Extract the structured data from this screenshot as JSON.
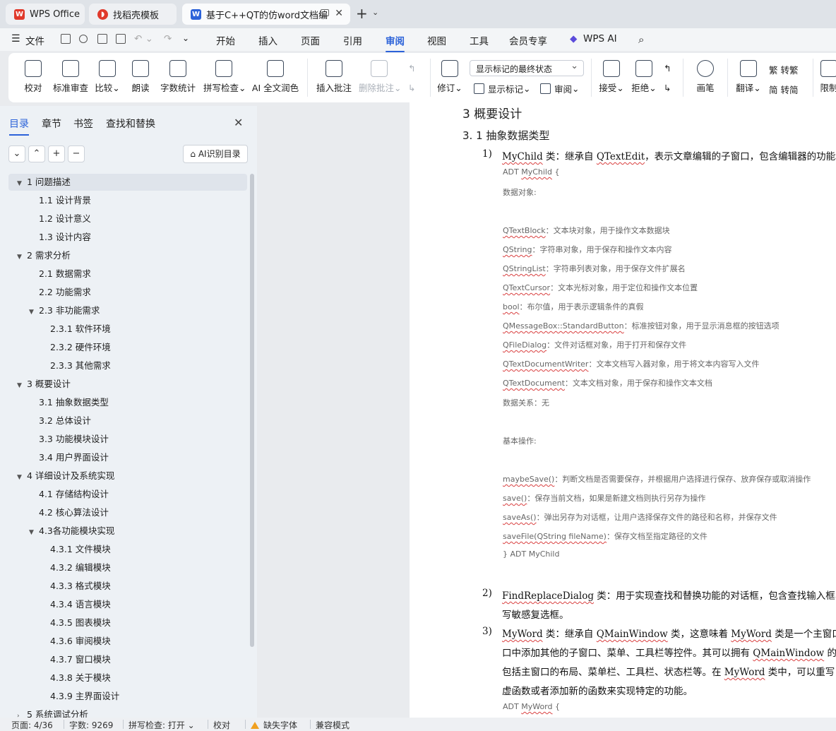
{
  "tabs": [
    {
      "label": "WPS Office",
      "icon": "wps-logo-icon",
      "icon_color": "#e0392b"
    },
    {
      "label": "找稻壳模板",
      "icon": "docer-icon",
      "icon_color": "#e0392b"
    },
    {
      "label": "基于C++QT的仿word文档编",
      "icon": "writer-doc-icon",
      "icon_color": "#2b62d9"
    }
  ],
  "menu": {
    "file": "文件",
    "items": [
      "开始",
      "插入",
      "页面",
      "引用",
      "审阅",
      "视图",
      "工具",
      "会员专享"
    ],
    "active": "审阅",
    "wps_ai": "WPS AI"
  },
  "ribbon": {
    "proofread": "校对",
    "standard_review": "标准审查",
    "compare": "比较",
    "read_aloud": "朗读",
    "word_count": "字数统计",
    "spell_check": "拼写检查",
    "ai_polish": "AI 全文润色",
    "insert_comment": "插入批注",
    "delete_comment": "删除批注",
    "track_changes": "修订",
    "markup_mode": "显示标记的最终状态",
    "show_markup": "显示标记",
    "review_pane": "审阅",
    "accept": "接受",
    "reject": "拒绝",
    "pen": "画笔",
    "translate": "翻译",
    "to_traditional": "转繁",
    "to_simplified": "转简",
    "restrict": "限制"
  },
  "panel": {
    "tabs": [
      "目录",
      "章节",
      "书签",
      "查找和替换"
    ],
    "ai_toc": "AI识别目录",
    "toc": [
      {
        "text": "1  问题描述",
        "level": 0,
        "expander": "▼"
      },
      {
        "text": "1.1  设计背景",
        "level": 1
      },
      {
        "text": "1.2  设计意义",
        "level": 1
      },
      {
        "text": "1.3  设计内容",
        "level": 1
      },
      {
        "text": "2  需求分析",
        "level": 0,
        "expander": "▼"
      },
      {
        "text": "2.1  数据需求",
        "level": 1
      },
      {
        "text": "2.2  功能需求",
        "level": 1
      },
      {
        "text": "2.3  非功能需求",
        "level": 1,
        "expander": "▼"
      },
      {
        "text": "2.3.1  软件环境",
        "level": 2
      },
      {
        "text": "2.3.2  硬件环境",
        "level": 2
      },
      {
        "text": "2.3.3  其他需求",
        "level": 2
      },
      {
        "text": "3  概要设计",
        "level": 0,
        "expander": "▼"
      },
      {
        "text": "3.1 抽象数据类型",
        "level": 1
      },
      {
        "text": "3.2  总体设计",
        "level": 1
      },
      {
        "text": "3.3  功能模块设计",
        "level": 1
      },
      {
        "text": "3.4  用户界面设计",
        "level": 1
      },
      {
        "text": "4  详细设计及系统实现",
        "level": 0,
        "expander": "▼"
      },
      {
        "text": "4.1  存储结构设计",
        "level": 1
      },
      {
        "text": "4.2  核心算法设计",
        "level": 1
      },
      {
        "text": "4.3各功能模块实现",
        "level": 1,
        "expander": "▼"
      },
      {
        "text": "4.3.1  文件模块",
        "level": 2
      },
      {
        "text": "4.3.2  编辑模块",
        "level": 2
      },
      {
        "text": "4.3.3  格式模块",
        "level": 2
      },
      {
        "text": "4.3.4  语言模块",
        "level": 2
      },
      {
        "text": "4.3.5  图表模块",
        "level": 2
      },
      {
        "text": "4.3.6  审阅模块",
        "level": 2
      },
      {
        "text": "4.3.7  窗口模块",
        "level": 2
      },
      {
        "text": "4.3.8  关于模块",
        "level": 2
      },
      {
        "text": "4.3.9  主界面设计",
        "level": 2
      },
      {
        "text": "5  系统调试分析",
        "level": 0,
        "expander": "›"
      }
    ]
  },
  "doc": {
    "h2": "3  概要设计",
    "h3": "3. 1 抽象数据类型",
    "item1_num": "1)",
    "item1_a": "MyChild",
    "item1_b": " 类：继承自 ",
    "item1_c": "QTextEdit",
    "item1_d": "，表示文章编辑的子窗口，包含编辑器的功能和",
    "adt1_a": "ADT ",
    "adt1_b": "MyChild",
    "adt1_c": " {",
    "data_objs": "数据对象:",
    "objs": [
      {
        "name": "QTextBlock",
        "desc": "：文本块对象，用于操作文本数据块"
      },
      {
        "name": "QString",
        "desc": "：字符串对象，用于保存和操作文本内容"
      },
      {
        "name": "QStringList",
        "desc": "：字符串列表对象，用于保存文件扩展名"
      },
      {
        "name": "QTextCursor",
        "desc": "：文本光标对象，用于定位和操作文本位置"
      },
      {
        "name": "bool",
        "desc": "：布尔值，用于表示逻辑条件的真假"
      },
      {
        "name": "QMessageBox::StandardButton",
        "desc": "：标准按钮对象，用于显示消息框的按钮选项"
      },
      {
        "name": "QFileDialog",
        "desc": "：文件对话框对象，用于打开和保存文件"
      },
      {
        "name": "QTextDocumentWriter",
        "desc": "：文本文档写入器对象，用于将文本内容写入文件"
      },
      {
        "name": "QTextDocument",
        "desc": "：文本文档对象，用于保存和操作文本文档"
      }
    ],
    "data_rel": "数据关系：无",
    "basic_ops": "基本操作:",
    "ops": [
      {
        "name": "maybeSave()",
        "desc": "：判断文档是否需要保存，并根据用户选择进行保存、放弃保存或取消操作"
      },
      {
        "name": "save()",
        "desc": "：保存当前文档，如果是新建文档则执行另存为操作"
      },
      {
        "name": "saveAs()",
        "desc": "：弹出另存为对话框，让用户选择保存文件的路径和名称，并保存文件"
      },
      {
        "name": "saveFile(QString fileName)",
        "desc": "：保存文档至指定路径的文件"
      }
    ],
    "end_adt": "} ADT MyChild",
    "item2_num": "2)",
    "item2_a": "FindReplaceDialog",
    "item2_b": " 类：用于实现查找和替换功能的对话框，包含查找输入框、",
    "item2_c": "写敏感复选框。",
    "item3_num": "3)",
    "item3_a": "MyWord",
    "item3_b": " 类：继承自 ",
    "item3_c": "QMainWindow",
    "item3_d": " 类，这意味着 ",
    "item3_e": "MyWord",
    "item3_f": " 类是一个主窗口类",
    "item3_l2a": "口中添加其他的子窗口、菜单、工具栏等控件。其可以拥有 ",
    "item3_l2b": "QMainWindow",
    "item3_l2c": " 的",
    "item3_l3a": "包括主窗口的布局、菜单栏、工具栏、状态栏等。在 ",
    "item3_l3b": "MyWord",
    "item3_l3c": " 类中，可以重写",
    "item3_l4": "虚函数或者添加新的函数来实现特定的功能。",
    "adt2_a": "ADT ",
    "adt2_b": "MyWord",
    "adt2_c": " {"
  },
  "status": {
    "page": "页面: 4/36",
    "words": "字数: 9269",
    "spell": "拼写检查: 打开",
    "proof": "校对",
    "missing_font": "缺失字体",
    "compat": "兼容模式"
  }
}
